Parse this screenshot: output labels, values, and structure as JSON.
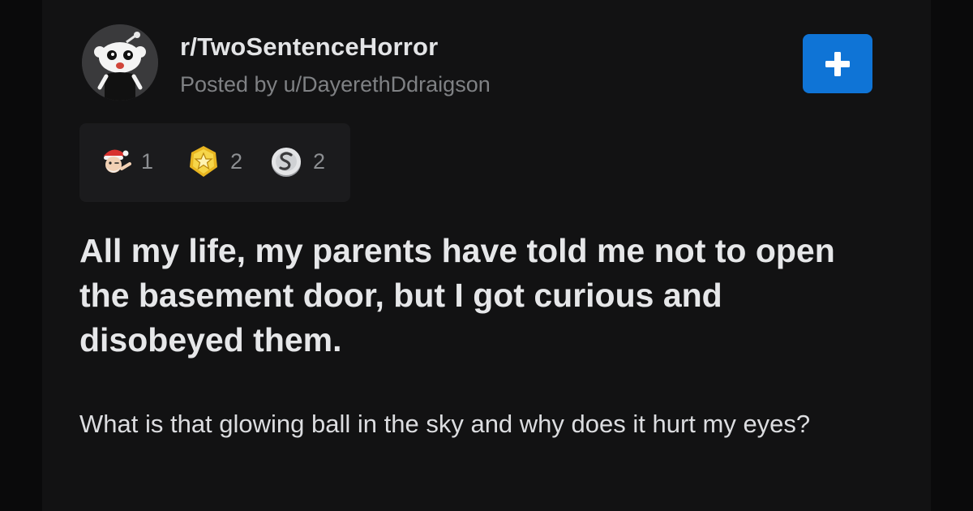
{
  "post": {
    "subreddit": "r/TwoSentenceHorror",
    "posted_by": "Posted by u/DayerethDdraigson",
    "title": "All my life, my parents have told me not to open the basement door, but I got curious and disobeyed them.",
    "body": "What is that glowing ball in the sky and why does it hurt my eyes?"
  },
  "join_button": {
    "icon": "plus-icon"
  },
  "awards": [
    {
      "icon": "santa-wink-award-icon",
      "count": "1"
    },
    {
      "icon": "gold-star-award-icon",
      "count": "2"
    },
    {
      "icon": "silver-coin-award-icon",
      "count": "2"
    }
  ],
  "colors": {
    "background": "#0a0a0b",
    "card": "#121213",
    "accent_button": "#0f74d6",
    "title_text": "#e6e7e9",
    "muted_text": "#7f8184"
  }
}
